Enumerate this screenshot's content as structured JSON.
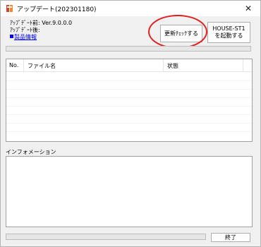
{
  "window": {
    "title": "アップデート(202301180)",
    "app_icon": "house-app-icon",
    "close_label": "✕"
  },
  "info": {
    "before_label": "ｱｯﾌﾟﾃﾞｰﾄ前: Ver.9.0.0.0",
    "after_label": "ｱｯﾌﾟﾃﾞｰﾄ後:",
    "product_link": "製品情報"
  },
  "buttons": {
    "check_update": "更新ﾁｪｯｸする",
    "launch_line1": "HOUSE-ST1",
    "launch_line2": "を起動する",
    "close": "終了"
  },
  "file_list": {
    "columns": [
      "No.",
      "ファイル名",
      "状態"
    ],
    "rows": []
  },
  "information": {
    "label": "インフォメーション",
    "text": ""
  },
  "colors": {
    "highlight_ellipse": "#e02020",
    "link": "#0000ee"
  }
}
